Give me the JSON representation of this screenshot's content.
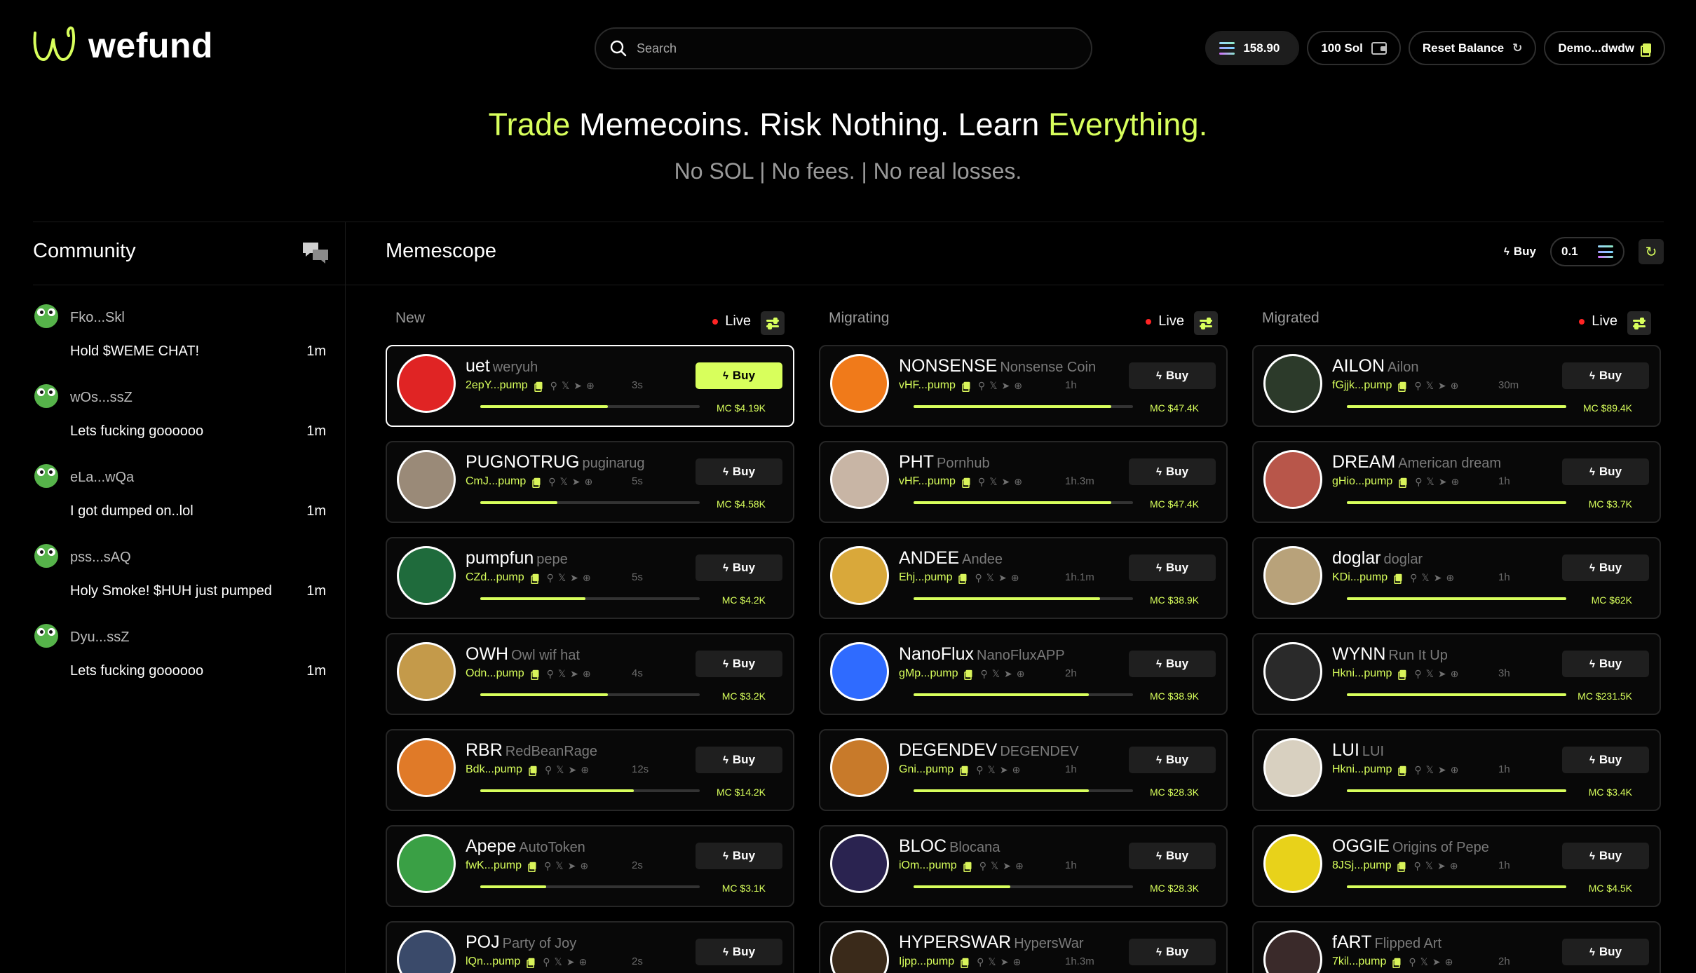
{
  "brand": {
    "name": "wefund",
    "accent_color": "#d8ff5c"
  },
  "search": {
    "placeholder": "Search"
  },
  "topbar": {
    "balance": "158.90",
    "sol_button": "100 Sol",
    "reset_button": "Reset Balance",
    "account": "Demo...dwdw"
  },
  "hero": {
    "w1": "Trade",
    "w2": "Memecoins. Risk Nothing. Learn",
    "w3": "Everything",
    "w4": ".",
    "subtitle": "No SOL | No fees. | No real losses."
  },
  "community": {
    "title": "Community",
    "messages": [
      {
        "user": "Fko...Skl",
        "text": "Hold $WEME CHAT!",
        "time": "1m"
      },
      {
        "user": "wOs...ssZ",
        "text": "Lets fucking goooooo",
        "time": "1m"
      },
      {
        "user": "eLa...wQa",
        "text": "I got dumped on..lol",
        "time": "1m"
      },
      {
        "user": "pss...sAQ",
        "text": "Holy Smoke! $HUH just pumped",
        "time": "1m"
      },
      {
        "user": "Dyu...ssZ",
        "text": "Lets fucking goooooo",
        "time": "1m"
      }
    ]
  },
  "memescope": {
    "title": "Memescope",
    "quick_buy_label": "Buy",
    "quick_buy_amount": "0.1",
    "live_label": "Live",
    "buy_label": "Buy",
    "columns": [
      {
        "title": "New",
        "tokens": [
          {
            "ticker": "uet",
            "name": "weryuh",
            "address": "2epY...pump",
            "age": "3s",
            "mc": "MC $4.19K",
            "progress": 0.58,
            "avatar": "#e02424",
            "selected": true
          },
          {
            "ticker": "PUGNOTRUG",
            "name": "puginarug",
            "address": "CmJ...pump",
            "age": "5s",
            "mc": "MC $4.58K",
            "progress": 0.35,
            "avatar": "#9a8a78"
          },
          {
            "ticker": "pumpfun",
            "name": "pepe",
            "address": "CZd...pump",
            "age": "5s",
            "mc": "MC $4.2K",
            "progress": 0.48,
            "avatar": "#1f6b3c"
          },
          {
            "ticker": "OWH",
            "name": "Owl wif hat",
            "address": "Odn...pump",
            "age": "4s",
            "mc": "MC $3.2K",
            "progress": 0.58,
            "avatar": "#c49a4a"
          },
          {
            "ticker": "RBR",
            "name": "RedBeanRage",
            "address": "Bdk...pump",
            "age": "12s",
            "mc": "MC $14.2K",
            "progress": 0.7,
            "avatar": "#e07a28"
          },
          {
            "ticker": "Apepe",
            "name": "AutoToken",
            "address": "fwK...pump",
            "age": "2s",
            "mc": "MC $3.1K",
            "progress": 0.3,
            "avatar": "#3aa045"
          },
          {
            "ticker": "POJ",
            "name": "Party of Joy",
            "address": "lQn...pump",
            "age": "2s",
            "mc": "",
            "progress": 0,
            "avatar": "#3a4a6a"
          }
        ]
      },
      {
        "title": "Migrating",
        "tokens": [
          {
            "ticker": "NONSENSE",
            "name": "Nonsense Coin",
            "address": "vHF...pump",
            "age": "1h",
            "mc": "MC $47.4K",
            "progress": 0.9,
            "avatar": "#f07a1a"
          },
          {
            "ticker": "PHT",
            "name": "Pornhub",
            "address": "vHF...pump",
            "age": "1h.3m",
            "mc": "MC $47.4K",
            "progress": 0.9,
            "avatar": "#c8b5a5"
          },
          {
            "ticker": "ANDEE",
            "name": "Andee",
            "address": "Ehj...pump",
            "age": "1h.1m",
            "mc": "MC $38.9K",
            "progress": 0.85,
            "avatar": "#d9a83a"
          },
          {
            "ticker": "NanoFlux",
            "name": "NanoFluxAPP",
            "address": "gMp...pump",
            "age": "2h",
            "mc": "MC $38.9K",
            "progress": 0.8,
            "avatar": "#2f6bff"
          },
          {
            "ticker": "DEGENDEV",
            "name": "DEGENDEV",
            "address": "Gni...pump",
            "age": "1h",
            "mc": "MC $28.3K",
            "progress": 0.8,
            "avatar": "#c87a2a"
          },
          {
            "ticker": "BLOC",
            "name": "Blocana",
            "address": "iOm...pump",
            "age": "1h",
            "mc": "MC $28.3K",
            "progress": 0.44,
            "avatar": "#2a2350"
          },
          {
            "ticker": "HYPERSWAR",
            "name": "HypersWar",
            "address": "Ijpp...pump",
            "age": "1h.3m",
            "mc": "",
            "progress": 0,
            "avatar": "#3a2a1a"
          }
        ]
      },
      {
        "title": "Migrated",
        "tokens": [
          {
            "ticker": "AILON",
            "name": "Ailon",
            "address": "fGjjk...pump",
            "age": "30m",
            "mc": "MC $89.4K",
            "progress": 1.0,
            "avatar": "#2c3a2a"
          },
          {
            "ticker": "DREAM",
            "name": "American dream",
            "address": "gHio...pump",
            "age": "1h",
            "mc": "MC $3.7K",
            "progress": 1.0,
            "avatar": "#b8564a"
          },
          {
            "ticker": "doglar",
            "name": "doglar",
            "address": "KDi...pump",
            "age": "1h",
            "mc": "MC $62K",
            "progress": 1.0,
            "avatar": "#b8a27a"
          },
          {
            "ticker": "WYNN",
            "name": "Run It Up",
            "address": "Hkni...pump",
            "age": "3h",
            "mc": "MC $231.5K",
            "progress": 1.0,
            "avatar": "#2a2a2a"
          },
          {
            "ticker": "LUI",
            "name": "LUI",
            "address": "Hkni...pump",
            "age": "1h",
            "mc": "MC $3.4K",
            "progress": 1.0,
            "avatar": "#d8d0c0"
          },
          {
            "ticker": "OGGIE",
            "name": "Origins of Pepe",
            "address": "8JSj...pump",
            "age": "1h",
            "mc": "MC $4.5K",
            "progress": 1.0,
            "avatar": "#e8d21a"
          },
          {
            "ticker": "fART",
            "name": "Flipped Art",
            "address": "7kil...pump",
            "age": "2h",
            "mc": "",
            "progress": 0,
            "avatar": "#3a2a2a"
          }
        ]
      }
    ]
  }
}
